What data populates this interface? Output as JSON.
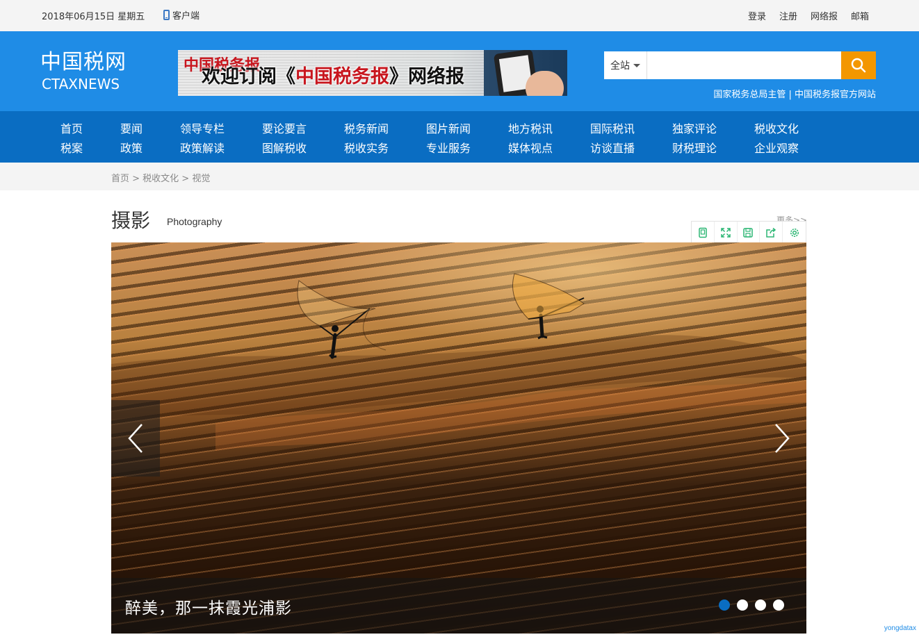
{
  "topbar": {
    "date": "2018年06月15日 星期五",
    "client": "客户端",
    "links": [
      "登录",
      "注册",
      "网络报",
      "邮箱"
    ]
  },
  "header": {
    "logo_cn": "中国税网",
    "logo_en": "CTAXNEWS",
    "banner_masthead": "中国税务报",
    "banner_text_a": "欢迎订阅《",
    "banner_text_b": "中国税务报",
    "banner_text_c": "》网络报",
    "search_scope": "全站",
    "search_placeholder": "",
    "slogan": "国家税务总局主管 | 中国税务报官方网站"
  },
  "nav": {
    "columns": [
      [
        "首页",
        "税案"
      ],
      [
        "要闻",
        "政策"
      ],
      [
        "领导专栏",
        "政策解读"
      ],
      [
        "要论要言",
        "图解税收"
      ],
      [
        "税务新闻",
        "税收实务"
      ],
      [
        "图片新闻",
        "专业服务"
      ],
      [
        "地方税讯",
        "媒体视点"
      ],
      [
        "国际税讯",
        "访谈直播"
      ],
      [
        "独家评论",
        "财税理论"
      ],
      [
        "税收文化",
        "企业观察"
      ]
    ]
  },
  "breadcrumb": "首页 > 税收文化 > 视觉",
  "section": {
    "title": "摄影",
    "subtitle": "Photography",
    "more": "更多>>",
    "tools": [
      "reader-icon",
      "fullscreen-icon",
      "save-icon",
      "share-icon",
      "settings-icon"
    ]
  },
  "slider": {
    "caption": "醉美，那一抹霞光浦影",
    "dots": 4,
    "active_dot": 0
  },
  "watermark": "yongdatax",
  "colors": {
    "header": "#1f8ce6",
    "nav": "#0a6dc2",
    "search_button": "#f39700",
    "tool_icons": "#2bb673"
  }
}
